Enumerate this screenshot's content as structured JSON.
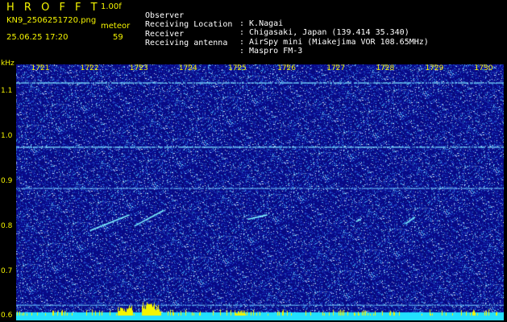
{
  "header": {
    "app_title": "H R O F F T",
    "version": "1.00f",
    "filename": "KN9_2506251720.png",
    "mode": "meteor",
    "datetime": "25.06.25 17:20",
    "count": "59"
  },
  "info": [
    {
      "label": "Observer",
      "value": ": K.Nagai"
    },
    {
      "label": "Receiving Location",
      "value": ": Chigasaki, Japan (139.414 35.340)"
    },
    {
      "label": "Receiver",
      "value": ": AirSpy mini (Miakejima VOR 108.65MHz)"
    },
    {
      "label": "Receiving antenna",
      "value": ": Maspro FM-3"
    }
  ],
  "colors": {
    "background": "#0a0a8c",
    "label": "#f5f500",
    "carrier": "#33e8ff",
    "baseline": "#22e0ff"
  },
  "chart_data": {
    "type": "heatmap",
    "ylabel": "kHz",
    "y_ticks": [
      "1.1",
      "1.0",
      "0.9",
      "0.8",
      "0.7",
      "0.6"
    ],
    "x_ticks": [
      "1721",
      "1722",
      "1723",
      "1724",
      "1725",
      "1726",
      "1727",
      "1728",
      "1729",
      "1730"
    ],
    "y_range": [
      0.59,
      1.16
    ],
    "x_range": [
      1720.5,
      1730.4
    ],
    "carrier_lines_khz": [
      1.12,
      0.977,
      0.885,
      0.625,
      0.607
    ],
    "meteor_echoes": [
      {
        "start_min": 1722.0,
        "end_min": 1722.8,
        "start_khz": 0.79,
        "end_khz": 0.825
      },
      {
        "start_min": 1722.9,
        "end_min": 1723.5,
        "start_khz": 0.8,
        "end_khz": 0.835
      },
      {
        "start_min": 1725.2,
        "end_min": 1725.6,
        "start_khz": 0.815,
        "end_khz": 0.825
      },
      {
        "start_min": 1727.4,
        "end_min": 1727.5,
        "start_khz": 0.81,
        "end_khz": 0.815
      },
      {
        "start_min": 1728.4,
        "end_min": 1728.6,
        "start_khz": 0.805,
        "end_khz": 0.82
      }
    ]
  }
}
